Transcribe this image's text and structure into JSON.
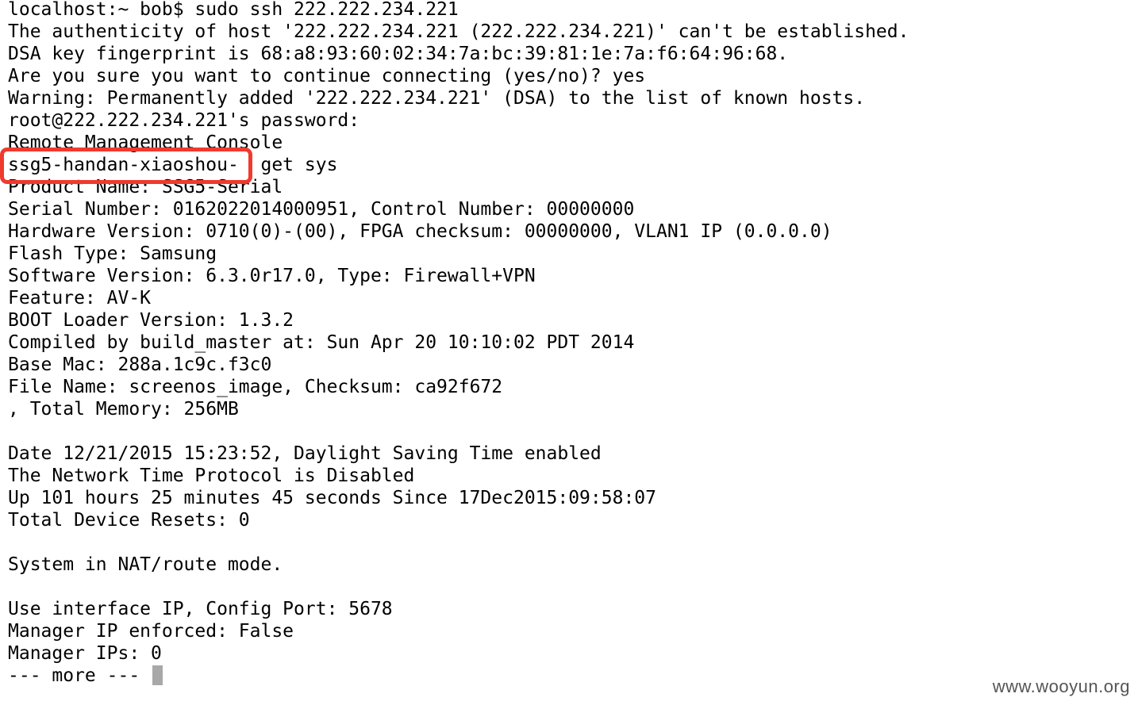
{
  "terminal": {
    "lines": [
      "localhost:~ bob$ sudo ssh 222.222.234.221",
      "The authenticity of host '222.222.234.221 (222.222.234.221)' can't be established.",
      "DSA key fingerprint is 68:a8:93:60:02:34:7a:bc:39:81:1e:7a:f6:64:96:68.",
      "Are you sure you want to continue connecting (yes/no)? yes",
      "Warning: Permanently added '222.222.234.221' (DSA) to the list of known hosts.",
      "root@222.222.234.221's password:",
      "Remote Management Console",
      "ssg5-handan-xiaoshou-  get sys",
      "Product Name: SSG5-Serial",
      "Serial Number: 0162022014000951, Control Number: 00000000",
      "Hardware Version: 0710(0)-(00), FPGA checksum: 00000000, VLAN1 IP (0.0.0.0)",
      "Flash Type: Samsung",
      "Software Version: 6.3.0r17.0, Type: Firewall+VPN",
      "Feature: AV-K",
      "BOOT Loader Version: 1.3.2",
      "Compiled by build_master at: Sun Apr 20 10:10:02 PDT 2014",
      "Base Mac: 288a.1c9c.f3c0",
      "File Name: screenos_image, Checksum: ca92f672",
      ", Total Memory: 256MB",
      "",
      "Date 12/21/2015 15:23:52, Daylight Saving Time enabled",
      "The Network Time Protocol is Disabled",
      "Up 101 hours 25 minutes 45 seconds Since 17Dec2015:09:58:07",
      "Total Device Resets: 0",
      "",
      "System in NAT/route mode.",
      "",
      "Use interface IP, Config Port: 5678",
      "Manager IP enforced: False",
      "Manager IPs: 0",
      "--- more --- "
    ],
    "cursor_line_index": 30
  },
  "annotation": {
    "color": "#f03a2e",
    "highlighted_line_index": 7
  },
  "watermark": {
    "text": "www.wooyun.org"
  }
}
